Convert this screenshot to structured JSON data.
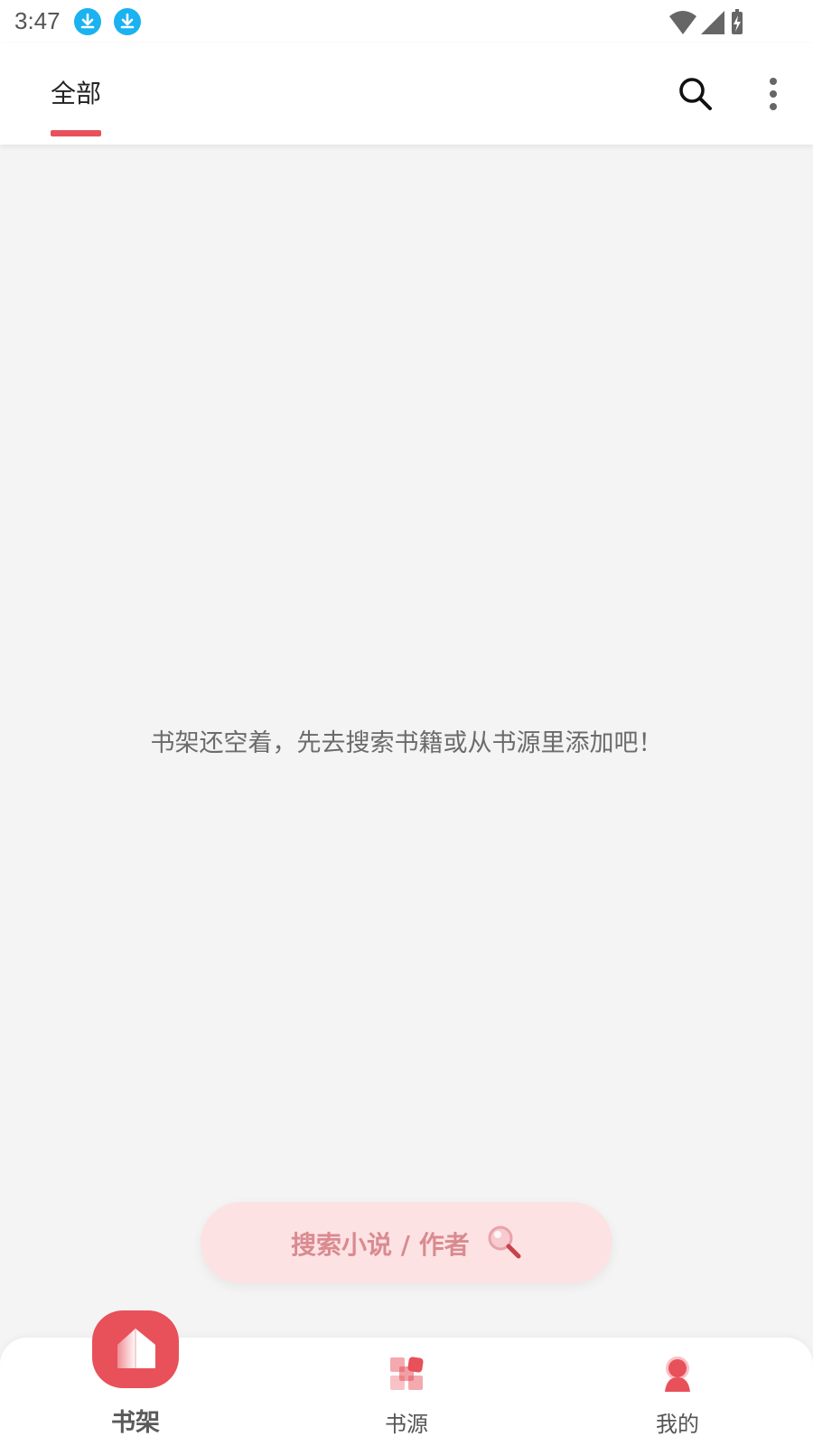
{
  "status_bar": {
    "time": "3:47",
    "notification_icons": [
      "download-icon",
      "download-icon"
    ],
    "system_icons": [
      "wifi-icon",
      "signal-icon",
      "battery-charging-icon"
    ]
  },
  "app_bar": {
    "tab_label": "全部",
    "actions": [
      "search-icon",
      "more-vert-icon"
    ]
  },
  "content": {
    "empty_message": "书架还空着，先去搜索书籍或从书源里添加吧！"
  },
  "search_pill": {
    "label": "搜索小说 / 作者",
    "icon": "magnifier-icon"
  },
  "bottom_nav": {
    "items": [
      {
        "label": "书架",
        "icon": "bookshelf-icon",
        "active": true
      },
      {
        "label": "书源",
        "icon": "book-source-icon",
        "active": false
      },
      {
        "label": "我的",
        "icon": "profile-icon",
        "active": false
      }
    ]
  },
  "colors": {
    "accent": "#e8515a",
    "pill_bg": "#fde2e4",
    "notification_blue": "#1ab2f0"
  }
}
